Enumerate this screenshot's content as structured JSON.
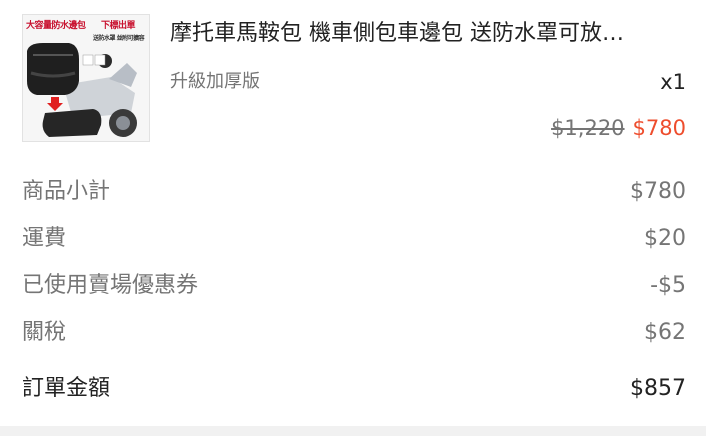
{
  "product": {
    "title": "摩托車馬鞍包 機車側包車邊包 送防水罩可放…",
    "variant": "升級加厚版",
    "quantity": "x1",
    "original_price": "$1,220",
    "final_price": "$780",
    "thumbnail_caption_left": "大容量防水邊包",
    "thumbnail_caption_right": "下標出單",
    "thumbnail_caption_sub": "送防水罩 並附可擴容"
  },
  "summary": {
    "subtotal_label": "商品小計",
    "subtotal_value": "$780",
    "shipping_label": "運費",
    "shipping_value": "$20",
    "voucher_label": "已使用賣場優惠券",
    "voucher_value": "-$5",
    "tax_label": "關稅",
    "tax_value": "$62",
    "total_label": "訂單金額",
    "total_value": "$857"
  },
  "colors": {
    "accent": "#ee4d2d",
    "muted_text": "#757575",
    "primary_text": "#222222"
  }
}
